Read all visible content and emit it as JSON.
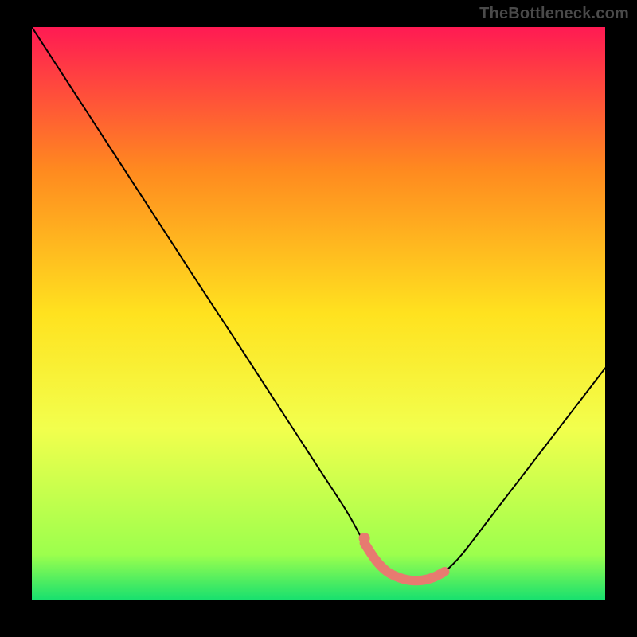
{
  "watermark": "TheBottleneck.com",
  "chart_data": {
    "type": "line",
    "title": "",
    "xlabel": "",
    "ylabel": "",
    "xlim": [
      0,
      100
    ],
    "ylim": [
      0,
      100
    ],
    "grid": false,
    "series": [
      {
        "name": "curve",
        "style": "black-thin",
        "x": [
          0,
          5,
          10,
          15,
          20,
          25,
          30,
          35,
          40,
          45,
          50,
          55,
          58,
          60,
          62,
          64,
          66,
          68,
          70,
          72,
          75,
          80,
          85,
          90,
          95,
          100
        ],
        "y": [
          100,
          92.3,
          84.6,
          76.9,
          69.2,
          61.5,
          53.8,
          46.2,
          38.5,
          30.8,
          23.1,
          15.4,
          10.0,
          7.0,
          5.0,
          4.0,
          3.5,
          3.5,
          4.0,
          5.0,
          8.0,
          14.5,
          21.0,
          27.5,
          34.0,
          40.5
        ]
      },
      {
        "name": "highlight",
        "style": "salmon-thick",
        "x": [
          58,
          60,
          62,
          64,
          66,
          68,
          70,
          72
        ],
        "y": [
          10.0,
          7.0,
          5.0,
          4.0,
          3.5,
          3.5,
          4.0,
          5.0
        ]
      }
    ],
    "background_gradient": {
      "top": "#ff1a53",
      "mid_upper": "#ff8a1f",
      "mid": "#ffe21f",
      "mid_lower": "#f2ff4d",
      "near_bottom": "#9cff4d",
      "bottom": "#16e06f"
    }
  }
}
